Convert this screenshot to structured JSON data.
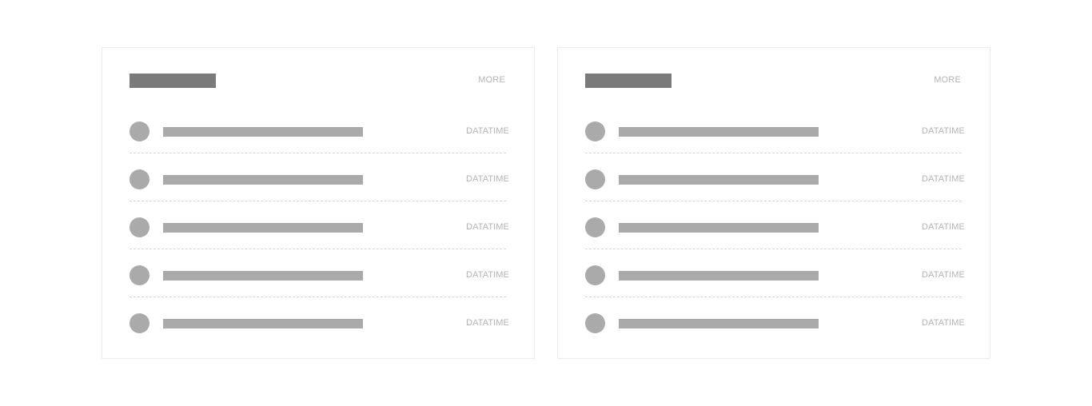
{
  "panels": [
    {
      "more_label": "MORE",
      "items": [
        {
          "datetime": "DATATIME"
        },
        {
          "datetime": "DATATIME"
        },
        {
          "datetime": "DATATIME"
        },
        {
          "datetime": "DATATIME"
        },
        {
          "datetime": "DATATIME"
        }
      ]
    },
    {
      "more_label": "MORE",
      "items": [
        {
          "datetime": "DATATIME"
        },
        {
          "datetime": "DATATIME"
        },
        {
          "datetime": "DATATIME"
        },
        {
          "datetime": "DATATIME"
        },
        {
          "datetime": "DATATIME"
        }
      ]
    }
  ],
  "colors": {
    "title_bar": "#7a7a7a",
    "placeholder": "#aaaaaa",
    "muted_text": "#b3b3b3",
    "card_border": "#ececec",
    "divider": "#d6d6d6"
  }
}
